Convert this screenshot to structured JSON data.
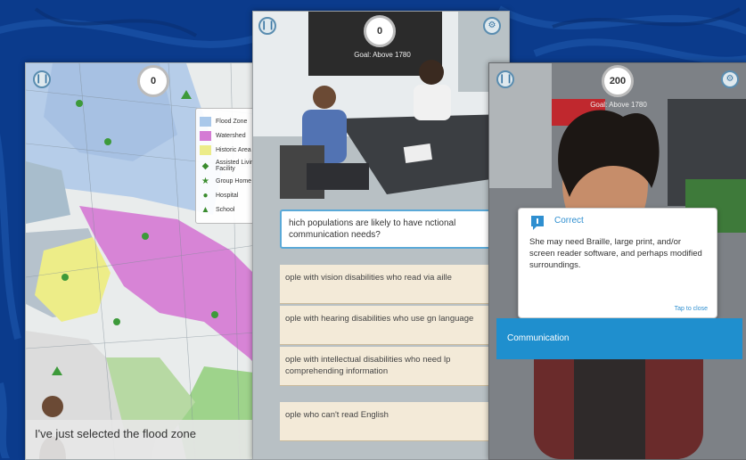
{
  "left_screen": {
    "score": "0",
    "legend": [
      {
        "label": "Flood Zone",
        "color": "#a9c8ea",
        "type": "swatch"
      },
      {
        "label": "Watershed",
        "color": "#d47bd4",
        "type": "swatch"
      },
      {
        "label": "Historic Area",
        "color": "#ecec8a",
        "type": "swatch"
      },
      {
        "label": "Assisted Living Facility",
        "icon": "diamond-icon",
        "type": "icon"
      },
      {
        "label": "Group Home",
        "icon": "star-icon",
        "type": "icon"
      },
      {
        "label": "Hospital",
        "icon": "circle-icon",
        "type": "icon"
      },
      {
        "label": "School",
        "icon": "triangle-icon",
        "type": "icon"
      }
    ],
    "caption": "I've just selected the flood zone"
  },
  "mid_screen": {
    "score": "0",
    "goal": "Goal: Above 1780",
    "question": "hich populations are likely to have nctional communication needs?",
    "answers": [
      "ople with vision disabilities who read via aille",
      "ople with hearing disabilities who use gn language",
      "ople with intellectual disabilities who need lp comprehending information",
      "ople who can't read English"
    ]
  },
  "right_screen": {
    "score": "200",
    "goal": "Goal: Above 1780",
    "popup_title": "Correct",
    "popup_text": "She may need Braille, large print, and/or screen reader software, and perhaps modified surroundings.",
    "popup_close": "Tap to close",
    "topic": "Communication"
  }
}
